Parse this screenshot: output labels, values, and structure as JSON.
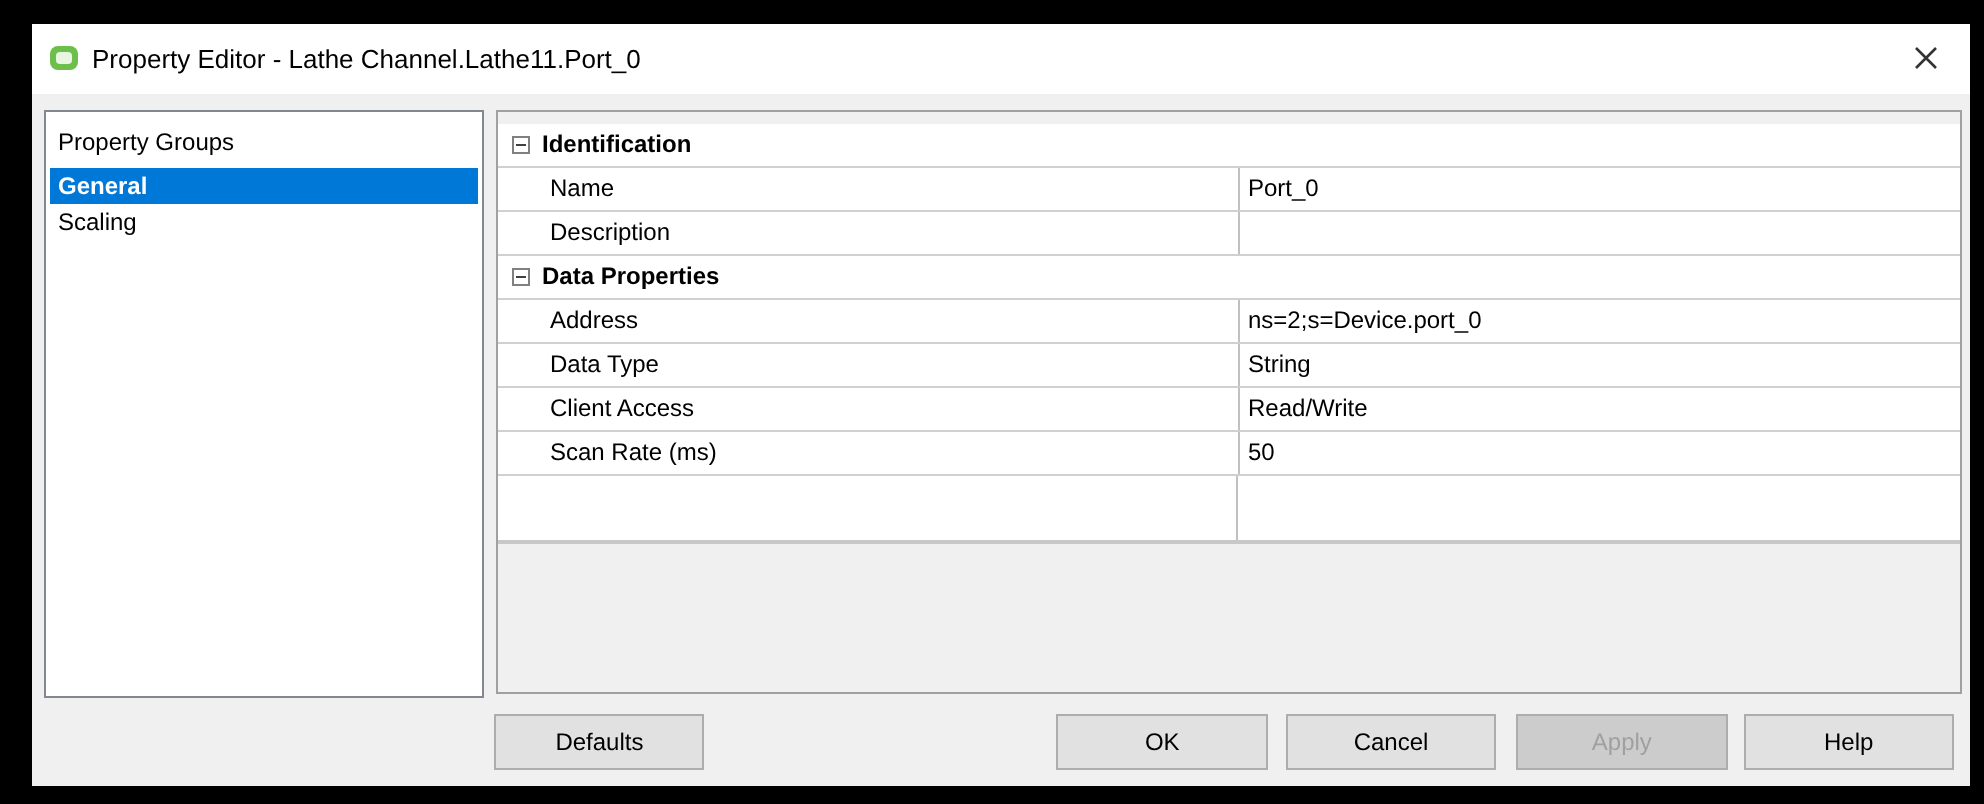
{
  "window": {
    "title": "Property Editor - Lathe Channel.Lathe11.Port_0"
  },
  "sidebar": {
    "heading": "Property Groups",
    "items": [
      {
        "label": "General",
        "selected": true
      },
      {
        "label": "Scaling",
        "selected": false
      }
    ]
  },
  "grid": {
    "categories": [
      {
        "name": "Identification",
        "expanded": true,
        "properties": [
          {
            "name": "Name",
            "value": "Port_0"
          },
          {
            "name": "Description"
          }
        ]
      },
      {
        "name": "Data Properties",
        "expanded": true,
        "properties": [
          {
            "name": "Address",
            "value": "ns=2;s=Device.port_0"
          },
          {
            "name": "Data Type",
            "value": "String"
          },
          {
            "name": "Client Access",
            "value": "Read/Write"
          },
          {
            "name": "Scan Rate (ms)",
            "value": "50"
          }
        ]
      }
    ]
  },
  "buttons": [
    {
      "label": "Defaults",
      "disabled": false
    },
    {
      "label": "OK",
      "disabled": false
    },
    {
      "label": "Cancel",
      "disabled": false
    },
    {
      "label": "Apply",
      "disabled": true
    },
    {
      "label": "Help",
      "disabled": false
    }
  ]
}
